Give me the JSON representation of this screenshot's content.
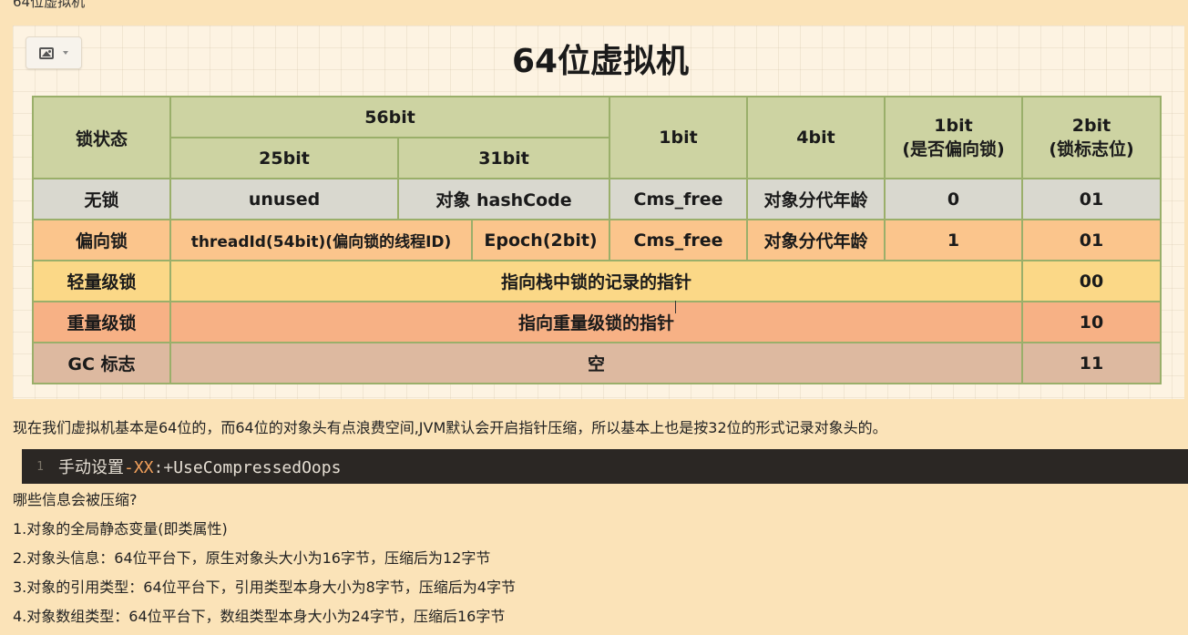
{
  "top_clipped_text": "64位虚拟机",
  "diagram": {
    "title": "64位虚拟机",
    "header": {
      "lock_state": "锁状态",
      "bit56": "56bit",
      "bit25": "25bit",
      "bit31": "31bit",
      "bit1": "1bit",
      "bit4": "4bit",
      "biased_flag_bits": "1bit",
      "biased_flag_label": "(是否偏向锁)",
      "lock_flag_bits": "2bit",
      "lock_flag_label": "(锁标志位)"
    },
    "rows": [
      {
        "state": "无锁",
        "c1": "unused",
        "c2": "对象 hashCode",
        "c3": "Cms_free",
        "c4": "对象分代年龄",
        "c5": "0",
        "c6": "01"
      },
      {
        "state": "偏向锁",
        "c1": "threadId(54bit)(偏向锁的线程ID)",
        "c2": "Epoch(2bit)",
        "c3": "Cms_free",
        "c4": "对象分代年龄",
        "c5": "1",
        "c6": "01"
      },
      {
        "state": "轻量级锁",
        "merged": "指向栈中锁的记录的指针",
        "c6": "00"
      },
      {
        "state": "重量级锁",
        "merged": "指向重量级锁的指针",
        "c6": "10"
      },
      {
        "state": "GC 标志",
        "merged": "空",
        "c6": "11"
      }
    ]
  },
  "paragraph": "现在我们虚拟机基本是64位的，而64位的对象头有点浪费空间,JVM默认会开启指针压缩，所以基本上也是按32位的形式记录对象头的。",
  "code": {
    "line_number": "1",
    "prefix": "手动设置",
    "flag": "-XX",
    "colon_plus": ":+",
    "option": "UseCompressedOops"
  },
  "list": {
    "question": "哪些信息会被压缩?",
    "items": [
      "1.对象的全局静态变量(即类属性)",
      "2.对象头信息：64位平台下，原生对象头大小为16字节，压缩后为12字节",
      "3.对象的引用类型：64位平台下，引用类型本身大小为8字节，压缩后为4字节",
      "4.对象数组类型：64位平台下，数组类型本身大小为24字节，压缩后16字节"
    ]
  },
  "colors": {
    "page_bg": "#fbe3b8",
    "header_bg": "#cdd3a2",
    "row_unlocked": "#d9d8cf",
    "row_biased": "#fbc58c",
    "row_lightweight": "#fbd887",
    "row_heavyweight": "#f7b185",
    "row_gc": "#ddb9a0",
    "code_bg": "#2b2724",
    "code_flag": "#f2a05b"
  }
}
